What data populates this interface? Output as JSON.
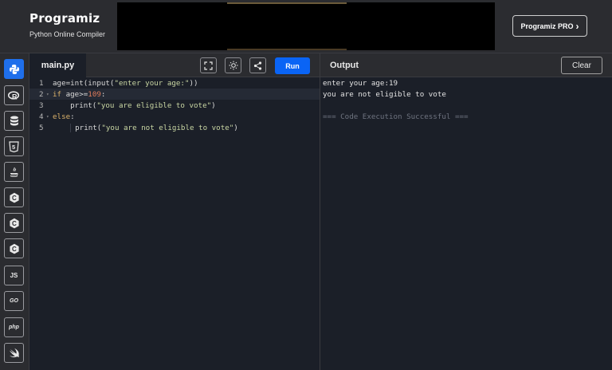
{
  "header": {
    "logo_text": "Programiz",
    "tagline": "Python Online Compiler",
    "pro_button": "Programiz PRO",
    "pro_chevron": "›"
  },
  "sidebar": {
    "languages": [
      {
        "name": "python",
        "label": "",
        "icon": "python-icon",
        "active": true
      },
      {
        "name": "r",
        "label": "R",
        "icon": "r-icon"
      },
      {
        "name": "sql",
        "label": "",
        "icon": "database-icon"
      },
      {
        "name": "html",
        "label": "5",
        "icon": "html5-icon"
      },
      {
        "name": "java",
        "label": "",
        "icon": "java-icon"
      },
      {
        "name": "c",
        "label": "C",
        "icon": "c-icon"
      },
      {
        "name": "cpp",
        "label": "C",
        "icon": "cpp-icon"
      },
      {
        "name": "csharp",
        "label": "C",
        "icon": "csharp-icon"
      },
      {
        "name": "js",
        "label": "JS",
        "icon": "javascript-icon"
      },
      {
        "name": "go",
        "label": "GO",
        "icon": "go-icon"
      },
      {
        "name": "php",
        "label": "php",
        "icon": "php-icon"
      },
      {
        "name": "swift",
        "label": "",
        "icon": "swift-icon"
      }
    ]
  },
  "editor": {
    "file_name": "main.py",
    "run_label": "Run",
    "lines": [
      {
        "n": "1",
        "text": "age=int(input(\"enter your age:\"))"
      },
      {
        "n": "2",
        "text": "if age>=109:"
      },
      {
        "n": "3",
        "text": "    print(\"you are eligible to vote\")"
      },
      {
        "n": "4",
        "text": "else:"
      },
      {
        "n": "5",
        "text": "    print(\"you are not eligible to vote\")"
      }
    ]
  },
  "output": {
    "title": "Output",
    "clear_label": "Clear",
    "lines": [
      "enter your age:19",
      "you are not eligible to vote",
      "",
      "=== Code Execution Successful ==="
    ]
  }
}
